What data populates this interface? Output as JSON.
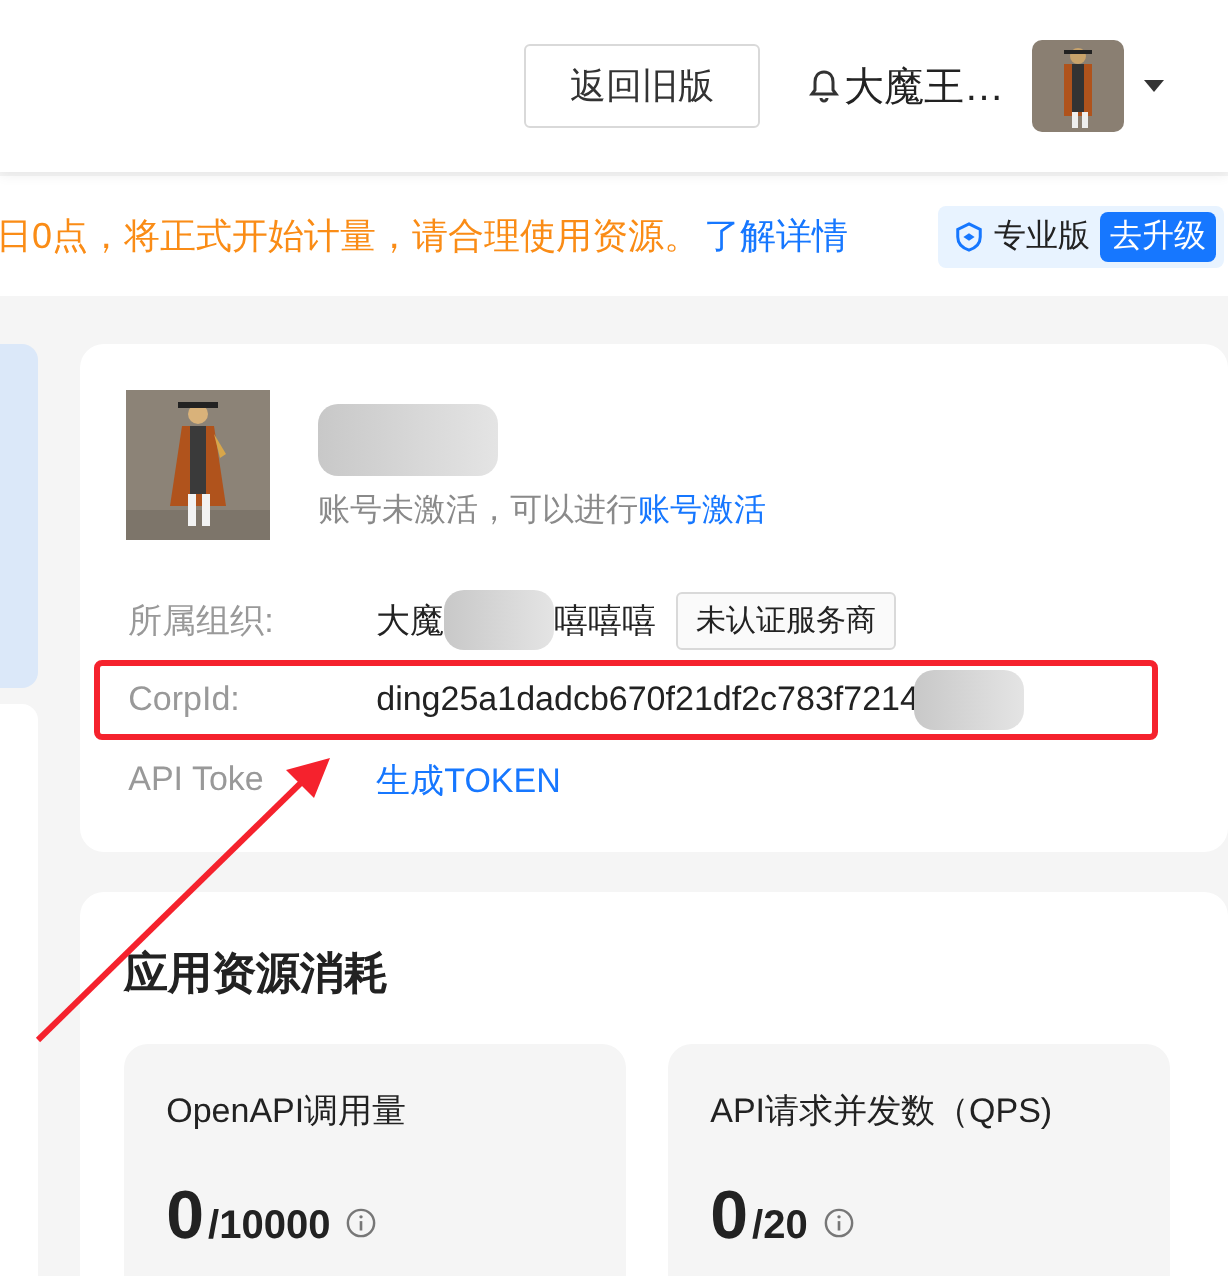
{
  "header": {
    "back_button": "返回旧版",
    "user_name": "大魔王…"
  },
  "notice": {
    "text": "日0点，将正式开始计量，请合理使用资源。",
    "link": "了解详情",
    "plan": "专业版",
    "upgrade": "去升级"
  },
  "profile": {
    "status_text": "账号未激活，可以进行",
    "activate_link": "账号激活",
    "fields": [
      {
        "kind": "org",
        "label": "所属组织:",
        "value_start": "大魔",
        "value_end": "嘻嘻嘻",
        "tag": "未认证服务商"
      },
      {
        "kind": "id",
        "label": "CorpId:",
        "value": "ding25a1dadcb670f21df2c783f7214",
        "highlighted": true
      },
      {
        "kind": "link",
        "label": "API Toke",
        "link": "生成TOKEN"
      }
    ]
  },
  "resources": {
    "title": "应用资源消耗",
    "metrics": [
      {
        "title": "OpenAPI调用量",
        "value": "0",
        "limit": "/10000"
      },
      {
        "title": "API请求并发数（QPS)",
        "value": "0",
        "limit": "/20"
      }
    ]
  }
}
